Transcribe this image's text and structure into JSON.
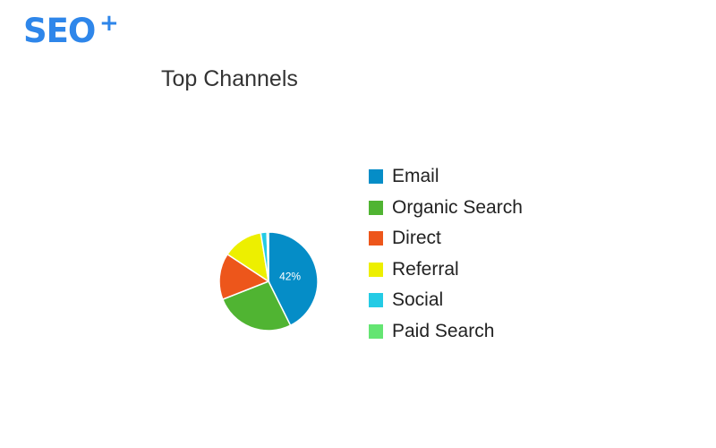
{
  "logo": {
    "text": "SEO",
    "superscript": "+"
  },
  "chart_data": {
    "type": "pie",
    "title": "Top Channels",
    "categories": [
      "Email",
      "Organic Search",
      "Direct",
      "Referral",
      "Social",
      "Paid Search"
    ],
    "values": [
      42,
      26,
      15,
      13,
      2,
      0.5
    ],
    "colors": [
      "#058dc7",
      "#50b432",
      "#ed561b",
      "#edef00",
      "#24cbe5",
      "#64e572"
    ],
    "data_labels": [
      "42%",
      "",
      "",
      "",
      "",
      ""
    ],
    "legend_position": "right"
  }
}
